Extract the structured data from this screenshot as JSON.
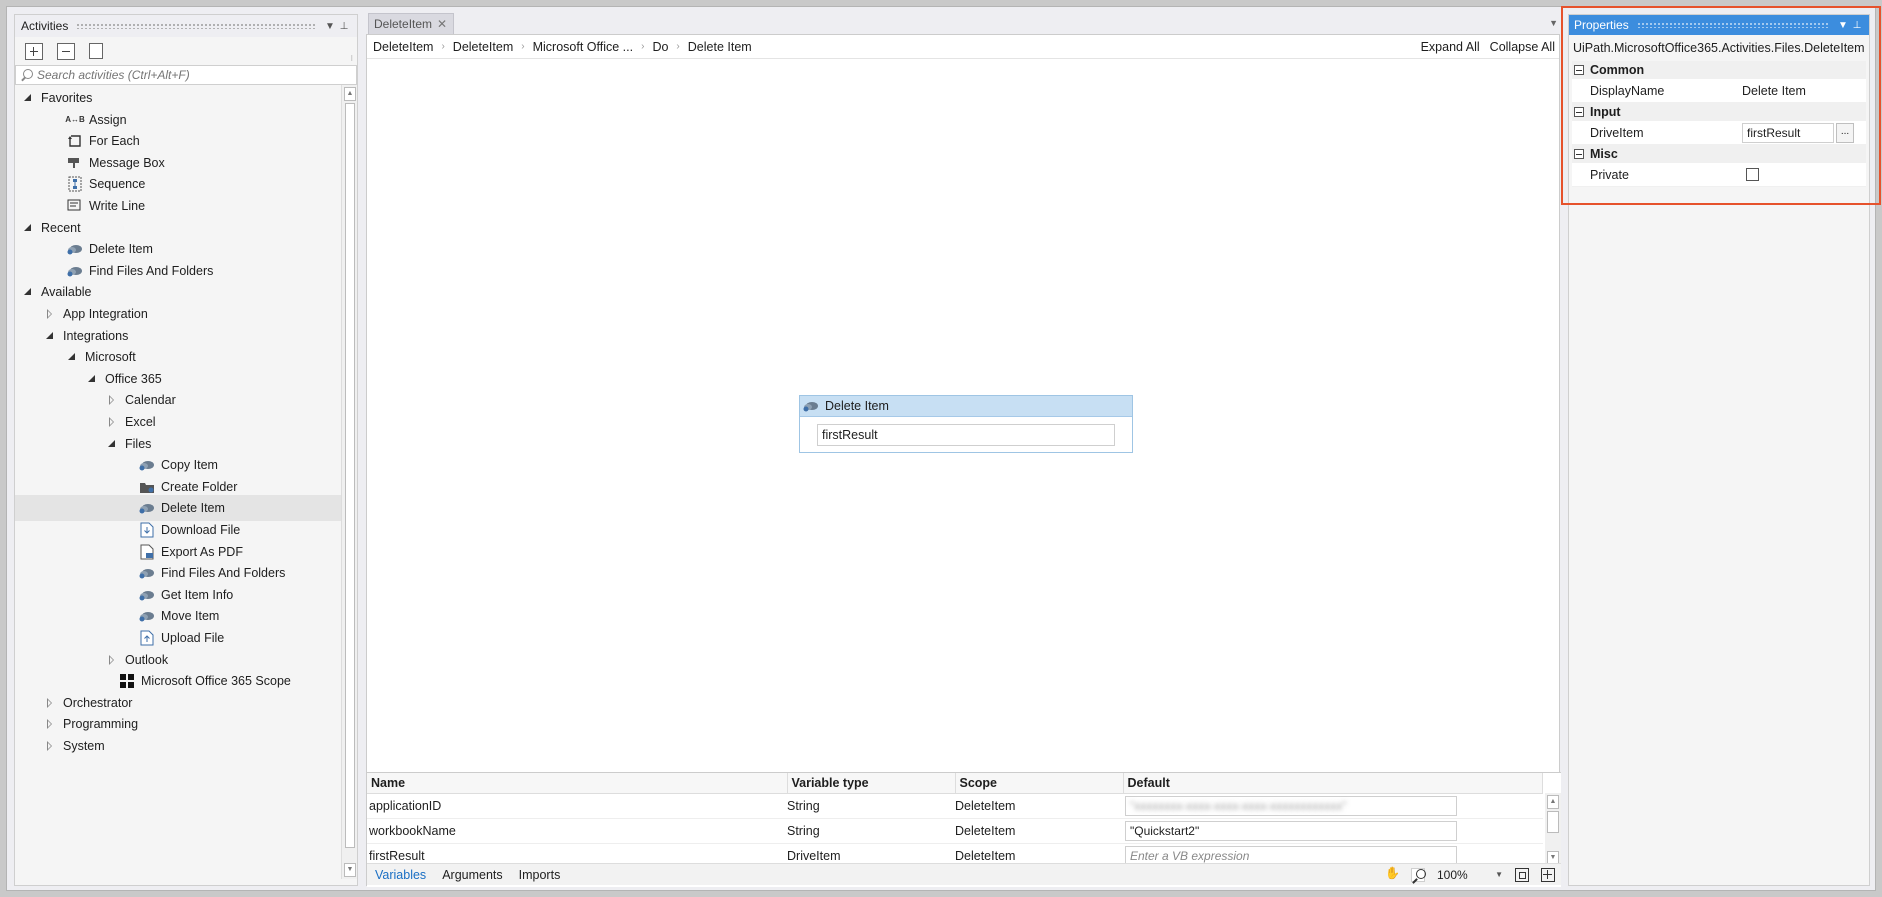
{
  "activities": {
    "title": "Activities",
    "search_placeholder": "Search activities (Ctrl+Alt+F)",
    "tree": [
      {
        "label": "Favorites",
        "level": 0,
        "arrow": "open",
        "icon": ""
      },
      {
        "label": "Assign",
        "level": 2,
        "arrow": "none",
        "icon": "assign-icon"
      },
      {
        "label": "For Each",
        "level": 2,
        "arrow": "none",
        "icon": "for-each-icon"
      },
      {
        "label": "Message Box",
        "level": 2,
        "arrow": "none",
        "icon": "message-box-icon"
      },
      {
        "label": "Sequence",
        "level": 2,
        "arrow": "none",
        "icon": "sequence-icon"
      },
      {
        "label": "Write Line",
        "level": 2,
        "arrow": "none",
        "icon": "write-line-icon"
      },
      {
        "label": "Recent",
        "level": 0,
        "arrow": "open",
        "icon": ""
      },
      {
        "label": "Delete Item",
        "level": 2,
        "arrow": "none",
        "icon": "cloud-icon"
      },
      {
        "label": "Find Files And Folders",
        "level": 2,
        "arrow": "none",
        "icon": "cloud-icon"
      },
      {
        "label": "Available",
        "level": 0,
        "arrow": "open",
        "icon": ""
      },
      {
        "label": "App Integration",
        "level": 1,
        "arrow": "closed",
        "icon": ""
      },
      {
        "label": "Integrations",
        "level": 1,
        "arrow": "open",
        "icon": ""
      },
      {
        "label": "Microsoft",
        "level": 2,
        "arrow": "open",
        "icon": ""
      },
      {
        "label": "Office 365",
        "level": 3,
        "arrow": "open",
        "icon": ""
      },
      {
        "label": "Calendar",
        "level": 4,
        "arrow": "closed",
        "icon": ""
      },
      {
        "label": "Excel",
        "level": 4,
        "arrow": "closed",
        "icon": ""
      },
      {
        "label": "Files",
        "level": 4,
        "arrow": "open",
        "icon": ""
      },
      {
        "label": "Copy Item",
        "level": 6,
        "arrow": "none",
        "icon": "cloud-icon"
      },
      {
        "label": "Create Folder",
        "level": 6,
        "arrow": "none",
        "icon": "folder-icon"
      },
      {
        "label": "Delete Item",
        "level": 6,
        "arrow": "none",
        "icon": "cloud-icon",
        "selected": true
      },
      {
        "label": "Download File",
        "level": 6,
        "arrow": "none",
        "icon": "file-download-icon"
      },
      {
        "label": "Export As PDF",
        "level": 6,
        "arrow": "none",
        "icon": "file-pdf-icon"
      },
      {
        "label": "Find Files And Folders",
        "level": 6,
        "arrow": "none",
        "icon": "cloud-icon"
      },
      {
        "label": "Get Item Info",
        "level": 6,
        "arrow": "none",
        "icon": "cloud-icon"
      },
      {
        "label": "Move Item",
        "level": 6,
        "arrow": "none",
        "icon": "cloud-icon"
      },
      {
        "label": "Upload File",
        "level": 6,
        "arrow": "none",
        "icon": "file-upload-icon"
      },
      {
        "label": "Outlook",
        "level": 4,
        "arrow": "closed",
        "icon": ""
      },
      {
        "label": "Microsoft Office 365 Scope",
        "level": 5,
        "arrow": "none",
        "icon": "windows-logo-icon"
      },
      {
        "label": "Orchestrator",
        "level": 1,
        "arrow": "closed",
        "icon": ""
      },
      {
        "label": "Programming",
        "level": 1,
        "arrow": "closed",
        "icon": ""
      },
      {
        "label": "System",
        "level": 1,
        "arrow": "closed",
        "icon": ""
      }
    ]
  },
  "designer": {
    "tab_label": "DeleteItem",
    "tab_close": "✕",
    "breadcrumb": [
      "DeleteItem",
      "DeleteItem",
      "Microsoft Office ...",
      "Do",
      "Delete Item"
    ],
    "expand_all": "Expand All",
    "collapse_all": "Collapse All",
    "activity": {
      "title": "Delete Item",
      "field_value": "firstResult"
    },
    "variables": {
      "headers": [
        "Name",
        "Variable type",
        "Scope",
        "Default"
      ],
      "rows": [
        {
          "name": "applicationID",
          "type": "String",
          "scope": "DeleteItem",
          "default": "\"xxxxxxxx-xxxx-xxxx-xxxx-xxxxxxxxxxxx\"",
          "default_style": "blur"
        },
        {
          "name": "workbookName",
          "type": "String",
          "scope": "DeleteItem",
          "default": "\"Quickstart2\"",
          "default_style": "normal"
        },
        {
          "name": "firstResult",
          "type": "DriveItem",
          "scope": "DeleteItem",
          "default": "Enter a VB expression",
          "default_style": "placeholder"
        }
      ]
    },
    "bottom_tabs": [
      "Variables",
      "Arguments",
      "Imports"
    ],
    "zoom": "100%"
  },
  "properties": {
    "title": "Properties",
    "type_name": "UiPath.MicrosoftOffice365.Activities.Files.DeleteItem",
    "categories": [
      {
        "name": "Common",
        "rows": [
          {
            "label": "DisplayName",
            "value": "Delete Item",
            "kind": "text"
          }
        ]
      },
      {
        "name": "Input",
        "rows": [
          {
            "label": "DriveItem",
            "value": "firstResult",
            "kind": "input"
          }
        ]
      },
      {
        "name": "Misc",
        "rows": [
          {
            "label": "Private",
            "value": "",
            "kind": "checkbox"
          }
        ]
      }
    ],
    "ellipsis": "..."
  },
  "colors": {
    "accent": "#3c8dde",
    "activity_header": "#c7dff3",
    "highlight_border": "#e6522c",
    "link_active": "#1a6fc4"
  }
}
